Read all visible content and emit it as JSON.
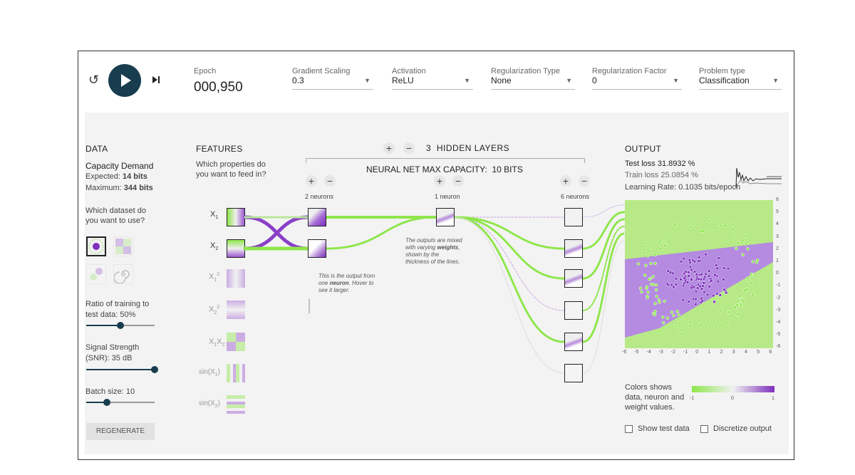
{
  "controls": {
    "reset_icon": "reset-icon",
    "play_icon": "play-icon",
    "step_icon": "step-icon",
    "epoch_label": "Epoch",
    "epoch_value": "000,950",
    "gradient_scaling": {
      "label": "Gradient Scaling",
      "value": "0.3"
    },
    "activation": {
      "label": "Activation",
      "value": "ReLU"
    },
    "regularization_type": {
      "label": "Regularization Type",
      "value": "None"
    },
    "regularization_factor": {
      "label": "Regularization Factor",
      "value": "0"
    },
    "problem_type": {
      "label": "Problem type",
      "value": "Classification"
    }
  },
  "data_panel": {
    "title": "DATA",
    "capacity_title": "Capacity Demand",
    "expected_label": "Expected:",
    "expected_value": "14 bits",
    "maximum_label": "Maximum:",
    "maximum_value": "344 bits",
    "dataset_question": "Which dataset do you want to use?",
    "ratio_label": "Ratio of training to test data:",
    "ratio_value": "50%",
    "ratio_fraction": 0.5,
    "noise_label": "Signal Strength (SNR):",
    "noise_value": "35 dB",
    "noise_fraction": 1.0,
    "batch_label": "Batch size:",
    "batch_value": "10",
    "batch_fraction": 0.3,
    "regenerate_label": "REGENERATE"
  },
  "features_panel": {
    "title": "FEATURES",
    "question": "Which properties do you want to feed in?",
    "features": [
      "X1",
      "X2",
      "X1²",
      "X2²",
      "X1X2",
      "sin(X1)",
      "sin(X2)"
    ]
  },
  "network": {
    "hidden_layers_count": "3",
    "hidden_layers_label": "HIDDEN LAYERS",
    "capacity_label": "NEURAL NET MAX CAPACITY:",
    "capacity_value": "10 BITS",
    "layers": [
      {
        "label": "2 neurons",
        "count": 2
      },
      {
        "label": "1 neuron",
        "count": 1
      },
      {
        "label": "6 neurons",
        "count": 6
      }
    ],
    "callout_neuron": {
      "pre": "This is the output from one ",
      "bold": "neuron",
      "post": ". Hover to see it larger."
    },
    "callout_weights": {
      "pre": "The outputs are mixed with varying ",
      "bold": "weights",
      "post": ", shown by the thickness of the lines."
    }
  },
  "output_panel": {
    "title": "OUTPUT",
    "test_loss_label": "Test loss",
    "test_loss_value": "31.8932 %",
    "train_loss_label": "Train loss",
    "train_loss_value": "25.0854 %",
    "learning_rate_label": "Learning Rate:",
    "learning_rate_value": "0.1035 bits/epoch",
    "axis_ticks": [
      "-6",
      "-5",
      "-4",
      "-3",
      "-2",
      "-1",
      "0",
      "1",
      "2",
      "3",
      "4",
      "5",
      "6"
    ],
    "legend_text": "Colors shows data, neuron and weight values.",
    "legend_ticks": [
      "-1",
      "0",
      "1"
    ],
    "show_test_label": "Show test data",
    "discretize_label": "Discretize output",
    "colors": {
      "positive": "#7e2fbd",
      "negative": "#8ee64a",
      "accent": "#183d4e"
    }
  }
}
